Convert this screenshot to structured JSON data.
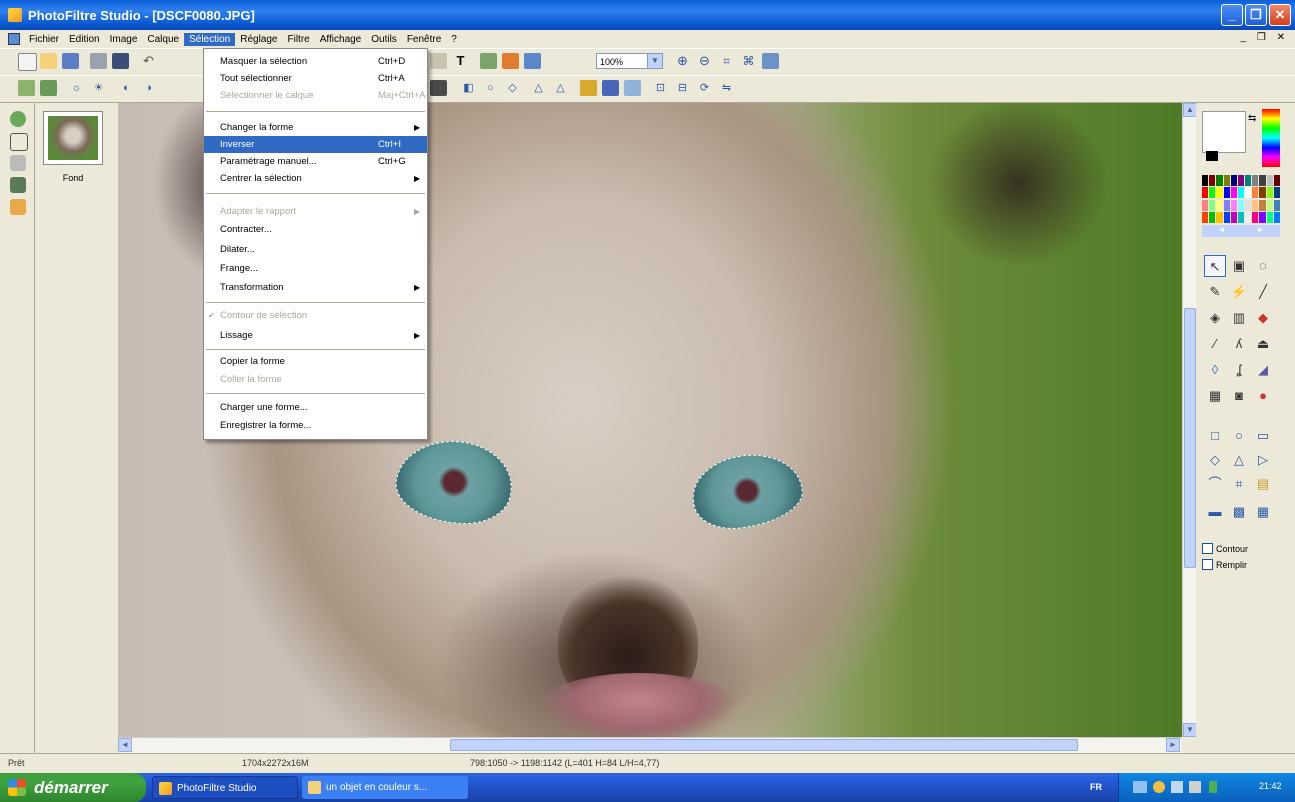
{
  "window": {
    "title": "PhotoFiltre Studio - [DSCF0080.JPG]",
    "buttons": [
      "_",
      "❐",
      "✕"
    ]
  },
  "menubar": {
    "items": [
      "Fichier",
      "Edition",
      "Image",
      "Calque",
      "Sélection",
      "Réglage",
      "Filtre",
      "Affichage",
      "Outils",
      "Fenêtre",
      "?"
    ],
    "mdi_controls": "_ ❐ ✕"
  },
  "toolbar": {
    "zoom_value": "100%",
    "zoom_dropdown": "▼"
  },
  "layers": {
    "items": [
      {
        "name": "Fond"
      }
    ]
  },
  "selection_menu": {
    "items": [
      {
        "label": "Masquer la sélection",
        "shortcut": "Ctrl+D",
        "disabled": false
      },
      {
        "label": "Tout sélectionner",
        "shortcut": "Ctrl+A",
        "disabled": false
      },
      {
        "label": "Sélectionner le calque",
        "shortcut": "Maj+Ctrl+A",
        "disabled": true
      },
      {
        "label": "Changer la forme",
        "submenu": true
      },
      {
        "label": "Inverser",
        "shortcut": "Ctrl+I",
        "highlighted": true
      },
      {
        "label": "Paramétrage manuel...",
        "shortcut": "Ctrl+G"
      },
      {
        "label": "Centrer la sélection",
        "submenu": true
      },
      {
        "label": "Adapter le rapport",
        "disabled": true,
        "submenu": true
      },
      {
        "label": "Contracter..."
      },
      {
        "label": "Dilater..."
      },
      {
        "label": "Frange..."
      },
      {
        "label": "Transformation",
        "submenu": true
      },
      {
        "label": "Contour de sélection",
        "disabled": true,
        "checked": true
      },
      {
        "label": "Lissage",
        "submenu": true
      },
      {
        "label": "Copier la forme"
      },
      {
        "label": "Coller la forme",
        "disabled": true
      },
      {
        "label": "Charger une forme..."
      },
      {
        "label": "Enregistrer la forme..."
      }
    ]
  },
  "tools_panel": {
    "contour_label": "Contour",
    "remplir_label": "Remplir",
    "palette_nav": [
      "◄",
      "►"
    ]
  },
  "statusbar": {
    "state": "Prêt",
    "image_size": "1704x2272x16M",
    "selection_info": "798:1050 -> 1198:1142 (L=401 H=84 L/H=4,77)"
  },
  "taskbar": {
    "start_label": "démarrer",
    "tasks": [
      "PhotoFiltre Studio",
      "un objet en couleur s..."
    ],
    "lang": "FR",
    "clock": "21:42"
  },
  "colors": {
    "accent": "#316ac5",
    "titlebar": "#0a5fd8",
    "taskbar": "#245edb",
    "start": "#3fa33f"
  }
}
